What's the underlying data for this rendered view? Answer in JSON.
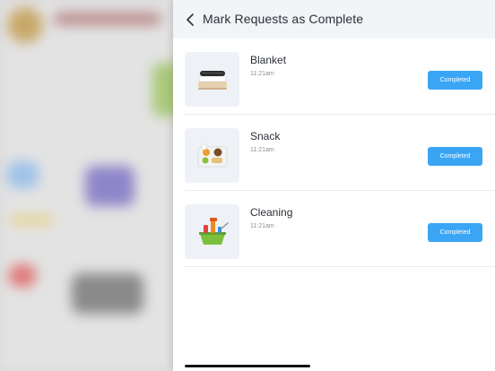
{
  "drawer": {
    "title": "Mark Requests as Complete",
    "back_icon": "chevron-left-icon"
  },
  "requests": [
    {
      "name": "Blanket",
      "time": "11:21am",
      "button_label": "Completed",
      "icon": "blanket-icon"
    },
    {
      "name": "Snack",
      "time": "11:21am",
      "button_label": "Completed",
      "icon": "snack-tray-icon"
    },
    {
      "name": "Cleaning",
      "time": "11:21am",
      "button_label": "Completed",
      "icon": "cleaning-basket-icon"
    }
  ],
  "colors": {
    "accent": "#3aa5f5",
    "header_bg": "#f2f4f7",
    "thumb_bg": "#eef2f6"
  }
}
